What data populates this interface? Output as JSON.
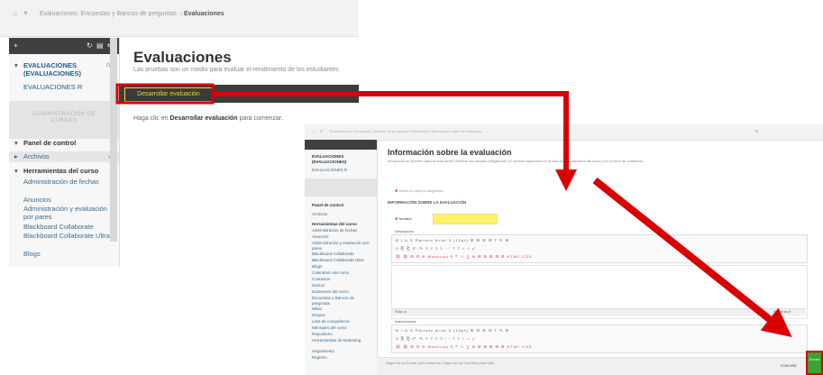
{
  "shot1": {
    "breadcrumb": "Evaluaciones, Encuestas y Bancos de preguntas",
    "breadcrumb_current": "Evaluaciones",
    "sidebar": {
      "course_title": "EVALUACIONES (EVALUACIONES)",
      "course_subtitle": "EVALUACIONES R",
      "admin_caption": "ADMINISTRACIÓN DE CURSOS",
      "items": [
        {
          "label": "Panel de control",
          "bold": true
        },
        {
          "label": "Archivos",
          "bold": false
        },
        {
          "label": "Herramientas del curso",
          "bold": true
        },
        {
          "label": "Administración de fechas",
          "bold": false
        },
        {
          "label": "Anuncios",
          "bold": false
        },
        {
          "label": "Administración y evaluación por pares",
          "bold": false
        },
        {
          "label": "Blackboard Collaborate",
          "bold": false
        },
        {
          "label": "Blackboard Collaborate Ultra",
          "bold": false
        },
        {
          "label": "Blogs",
          "bold": false
        }
      ]
    },
    "title": "Evaluaciones",
    "description": "Las pruebas son un medio para evaluar el rendimiento de los estudiantes",
    "create_button": "Desarrollar evaluación",
    "hint_prefix": "Haga clic en",
    "hint_bold": "Desarrollar evaluación",
    "hint_suffix": "para comenzar."
  },
  "shot2": {
    "breadcrumb": "Evaluaciones, Encuestas y Bancos de preguntas  Evaluaciones  Información sobre la evaluación",
    "sidebar_items": [
      "EVALUACIONES (EVALUACIONES)",
      "EVALUACIONES R",
      "Panel de control",
      "Archivos",
      "Herramientas del curso",
      "Administración de fechas",
      "Anuncios",
      "Administración y evaluación por pares",
      "Blackboard Collaborate",
      "Blackboard Collaborate Ultra",
      "Blogs",
      "Calendario del curso",
      "Contactos",
      "Diarios",
      "Exámenes del curso",
      "Encuestas y Bancos de preguntas",
      "Wikis",
      "Grupos",
      "Lista de compañeros",
      "Mensajes del curso",
      "Repositorio",
      "Herramientas de Marketing",
      "Seguimiento",
      "Registro"
    ],
    "title": "Información sobre la evaluación",
    "description": "Introduzca un Nombre para la evaluación. Rellene los campos obligatorios. El nombre aparecerá en la lista de evaluaciones del curso y en el área de contenido.",
    "required_note": "Indica un campo obligatorio.",
    "section_title": "INFORMACIÓN SOBRE LA EVALUACIÓN",
    "name_label": "Nombre",
    "description_label": "Descripción",
    "toolbar_row1": "B I U S  Párrafo  Arial  3 (12pt)  ☰ ☰ ☰ ☰  T  ✎  ⚙",
    "toolbar_row2": "X ⎘ ⎗ ↶ ↷  ≡ ≡ ≡ ≡  ⁝ ⁝  T T  ⌂ ⌂  ✓",
    "toolbar_row3": "⛓ ⛓ ⊞ ⊟  Φ  Mashups  ¶  ❝  ☺  ∑  ⊕  ⊞ ⊞ ⊞ ⊞ ⊞  HTML  CSS",
    "path_label": "Ruta: p",
    "path_right": "Palabras:0",
    "instructions_label": "Instrucciones",
    "footer_hint": "Haga clic en Enviar para continuar. Haga clic en Cancelar para salir.",
    "cancel_label": "Cancelar",
    "submit_label": "Enviar"
  },
  "colors": {
    "arrow": "#d90000",
    "highlight": "#fff26a",
    "submit": "#3aa235"
  }
}
